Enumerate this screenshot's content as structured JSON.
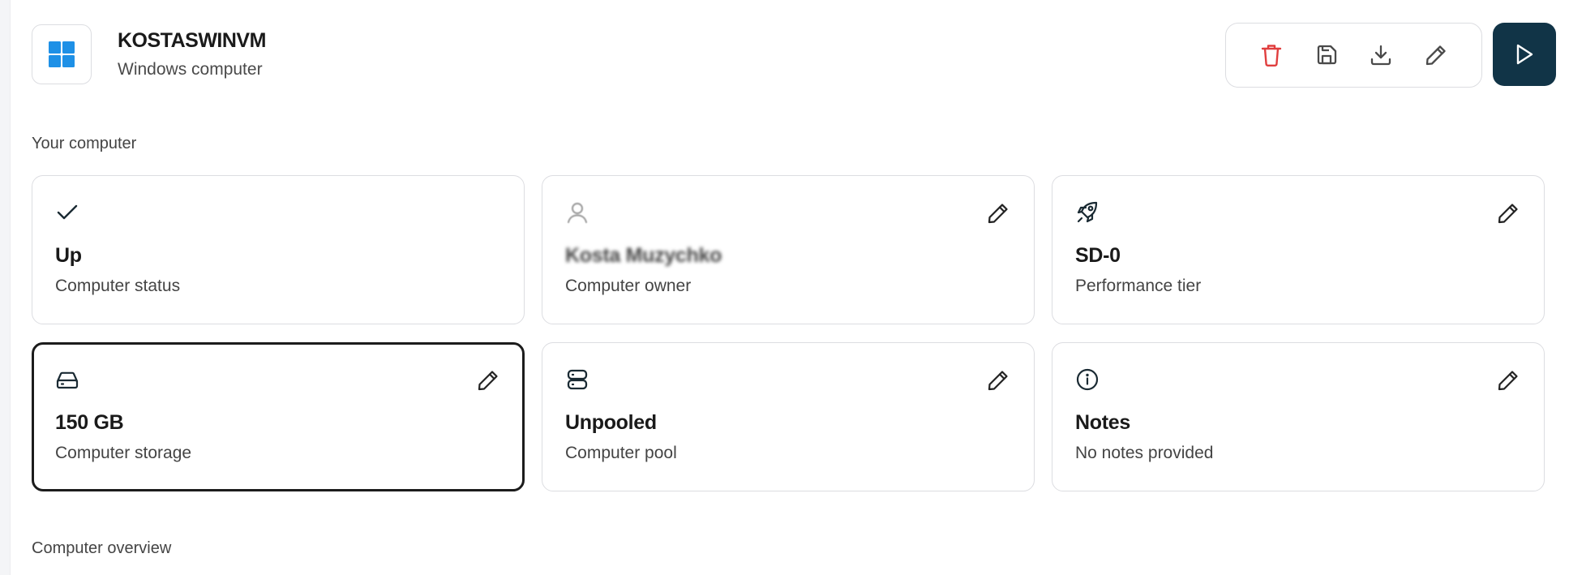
{
  "header": {
    "title": "KOSTASWINVM",
    "subtitle": "Windows computer",
    "app_icon": "windows-logo-icon",
    "actions": [
      {
        "name": "delete",
        "icon": "trash-icon",
        "color": "#e03e3e"
      },
      {
        "name": "save",
        "icon": "floppy-disk-icon",
        "color": "#4a4a4a"
      },
      {
        "name": "download",
        "icon": "download-icon",
        "color": "#4a4a4a"
      },
      {
        "name": "edit",
        "icon": "pencil-icon",
        "color": "#4a4a4a"
      }
    ],
    "run_button": {
      "icon": "play-icon",
      "color": "#113447"
    }
  },
  "sections": {
    "your_computer": "Your computer",
    "overview": "Computer overview"
  },
  "cards": [
    {
      "icon": "checkmark-icon",
      "value": "Up",
      "label": "Computer status",
      "editable": false
    },
    {
      "icon": "user-icon",
      "value": "Kosta Muzychko",
      "label": "Computer owner",
      "editable": true
    },
    {
      "icon": "rocket-icon",
      "value": "SD-0",
      "label": "Performance tier",
      "editable": true
    },
    {
      "icon": "hard-drive-icon",
      "value": "150 GB",
      "label": "Computer storage",
      "editable": true,
      "selected": true
    },
    {
      "icon": "server-icon",
      "value": "Unpooled",
      "label": "Computer pool",
      "editable": true
    },
    {
      "icon": "info-icon",
      "value": "Notes",
      "label": "No notes provided",
      "editable": true
    }
  ],
  "colors": {
    "accent": "#113447",
    "windows_blue": "#1e90e6",
    "danger": "#e03e3e",
    "border": "#dcdde1"
  }
}
